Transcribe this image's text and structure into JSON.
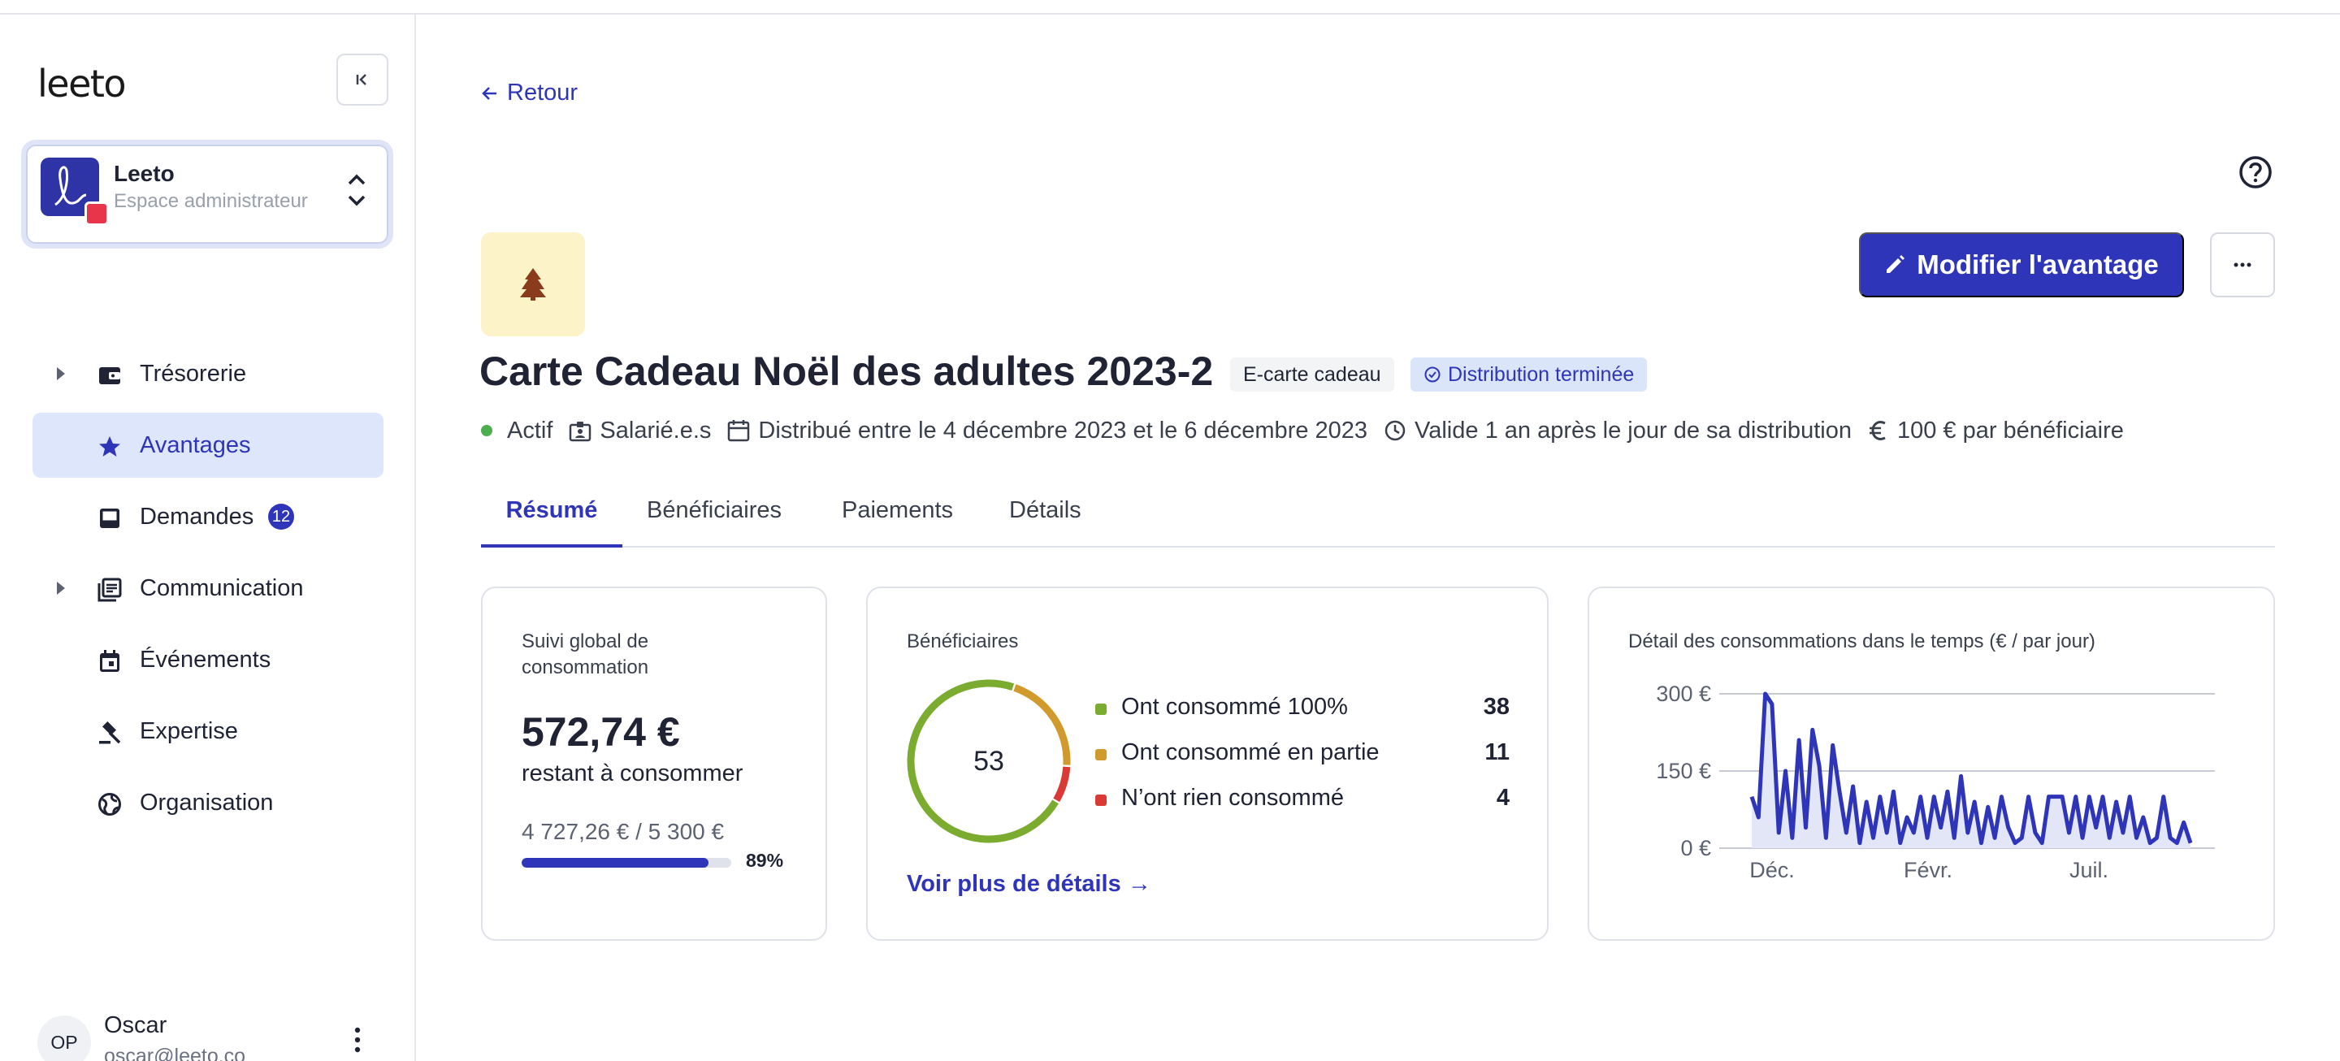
{
  "app": {
    "logo": "leeto"
  },
  "org": {
    "name": "Leeto",
    "subtitle": "Espace administrateur"
  },
  "sidebar": {
    "items": [
      {
        "label": "Trésorerie",
        "icon": "wallet-icon",
        "expandable": true,
        "active": false
      },
      {
        "label": "Avantages",
        "icon": "star-icon",
        "expandable": false,
        "active": true
      },
      {
        "label": "Demandes",
        "icon": "inbox-icon",
        "expandable": false,
        "active": false,
        "badge": "12"
      },
      {
        "label": "Communication",
        "icon": "newspaper-icon",
        "expandable": true,
        "active": false
      },
      {
        "label": "Événements",
        "icon": "calendar-icon",
        "expandable": false,
        "active": false
      },
      {
        "label": "Expertise",
        "icon": "gavel-icon",
        "expandable": false,
        "active": false
      },
      {
        "label": "Organisation",
        "icon": "globe-icon",
        "expandable": false,
        "active": false
      }
    ]
  },
  "user": {
    "initials": "OP",
    "name": "Oscar",
    "email": "oscar@leeto.co"
  },
  "header": {
    "back_label": "Retour",
    "edit_label": "Modifier l'avantage",
    "title": "Carte Cadeau Noël des adultes 2023-2",
    "type_tag": "E-carte cadeau",
    "status_tag": "Distribution terminée"
  },
  "meta": {
    "status": "Actif",
    "audience": "Salarié.e.s",
    "distribution": "Distribué entre le 4 décembre 2023 et le 6 décembre 2023",
    "validity": "Valide 1 an après le jour de sa distribution",
    "amount": "100 € par bénéficiaire"
  },
  "tabs": [
    {
      "label": "Résumé",
      "active": true
    },
    {
      "label": "Bénéficiaires",
      "active": false
    },
    {
      "label": "Paiements",
      "active": false
    },
    {
      "label": "Détails",
      "active": false
    }
  ],
  "consumption": {
    "title": "Suivi global de consommation",
    "remaining_amount": "572,74 €",
    "remaining_label": "restant à consommer",
    "ratio": "4 727,26 € / 5 300 €",
    "percent_label": "89%",
    "progress": 0.89
  },
  "beneficiaries": {
    "title": "Bénéficiaires",
    "total": "53",
    "rows": [
      {
        "label": "Ont consommé 100%",
        "value": 38,
        "color": "#7bab2f"
      },
      {
        "label": "Ont consommé en partie",
        "value": 11,
        "color": "#d19a2c"
      },
      {
        "label": "N’ont rien consommé",
        "value": 4,
        "color": "#d93a35"
      }
    ],
    "details_link": "Voir plus de détails"
  },
  "chart_data": {
    "type": "area",
    "title": "Détail des consommations dans le temps (€ / par jour)",
    "xlabel": "",
    "ylabel": "",
    "ylim": [
      0,
      300
    ],
    "yticks": [
      "0 €",
      "150 €",
      "300 €"
    ],
    "ytick_values": [
      0,
      150,
      300
    ],
    "xticks": [
      "Déc.",
      "Févr.",
      "Juil."
    ],
    "xtick_positions": [
      0.05,
      0.37,
      0.7
    ],
    "grid": true,
    "color": "#2f35b8",
    "values": [
      100,
      60,
      300,
      280,
      30,
      150,
      20,
      210,
      40,
      230,
      160,
      20,
      200,
      110,
      30,
      120,
      10,
      90,
      20,
      100,
      30,
      110,
      10,
      60,
      30,
      100,
      20,
      100,
      40,
      110,
      20,
      140,
      30,
      90,
      10,
      80,
      20,
      100,
      40,
      10,
      20,
      100,
      30,
      10,
      100,
      100,
      100,
      30,
      100,
      20,
      100,
      40,
      100,
      20,
      90,
      30,
      100,
      20,
      60,
      10,
      20,
      100,
      20,
      10,
      50,
      10
    ]
  }
}
